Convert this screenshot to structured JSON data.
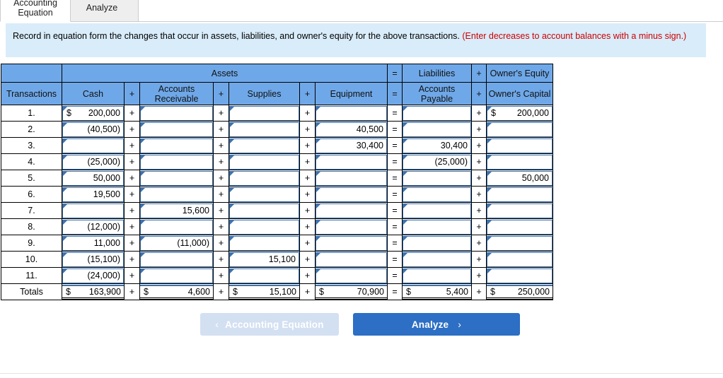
{
  "tabs": [
    {
      "label": "Accounting Equation",
      "active": true
    },
    {
      "label": "Analyze",
      "active": false
    }
  ],
  "instruction": {
    "main": "Record in equation form the changes that occur in assets, liabilities, and owner's equity for the above transactions.",
    "note": "(Enter decreases to account balances with a minus sign.)"
  },
  "table": {
    "group_headers": {
      "blank": "",
      "assets": "Assets",
      "eq": "=",
      "liabilities": "Liabilities",
      "plus": "+",
      "owners_equity": "Owner's Equity"
    },
    "column_headers": {
      "transactions": "Transactions",
      "cash": "Cash",
      "op1": "+",
      "accounts_receivable": "Accounts Receivable",
      "op2": "+",
      "supplies": "Supplies",
      "op3": "+",
      "equipment": "Equipment",
      "op4": "=",
      "accounts_payable": "Accounts Payable",
      "op5": "+",
      "owners_capital": "Owner's Capital"
    },
    "operators": {
      "plus": "+",
      "equals": "="
    },
    "dollar": "$",
    "totals_label": "Totals",
    "rows": [
      {
        "num": "1.",
        "cash": "200,000",
        "cash_dollar": true,
        "ar": "",
        "supplies": "",
        "equipment": "",
        "ap": "",
        "capital": "200,000",
        "capital_dollar": true
      },
      {
        "num": "2.",
        "cash": "(40,500)",
        "cash_dollar": false,
        "ar": "",
        "supplies": "",
        "equipment": "40,500",
        "ap": "",
        "capital": "",
        "capital_dollar": false
      },
      {
        "num": "3.",
        "cash": "",
        "cash_dollar": false,
        "ar": "",
        "supplies": "",
        "equipment": "30,400",
        "ap": "30,400",
        "capital": "",
        "capital_dollar": false
      },
      {
        "num": "4.",
        "cash": "(25,000)",
        "cash_dollar": false,
        "ar": "",
        "supplies": "",
        "equipment": "",
        "ap": "(25,000)",
        "capital": "",
        "capital_dollar": false
      },
      {
        "num": "5.",
        "cash": "50,000",
        "cash_dollar": false,
        "ar": "",
        "supplies": "",
        "equipment": "",
        "ap": "",
        "capital": "50,000",
        "capital_dollar": false
      },
      {
        "num": "6.",
        "cash": "19,500",
        "cash_dollar": false,
        "ar": "",
        "supplies": "",
        "equipment": "",
        "ap": "",
        "capital": "",
        "capital_dollar": false
      },
      {
        "num": "7.",
        "cash": "",
        "cash_dollar": false,
        "ar": "15,600",
        "supplies": "",
        "equipment": "",
        "ap": "",
        "capital": "",
        "capital_dollar": false
      },
      {
        "num": "8.",
        "cash": "(12,000)",
        "cash_dollar": false,
        "ar": "",
        "supplies": "",
        "equipment": "",
        "ap": "",
        "capital": "",
        "capital_dollar": false
      },
      {
        "num": "9.",
        "cash": "11,000",
        "cash_dollar": false,
        "ar": "(11,000)",
        "supplies": "",
        "equipment": "",
        "ap": "",
        "capital": "",
        "capital_dollar": false
      },
      {
        "num": "10.",
        "cash": "(15,100)",
        "cash_dollar": false,
        "ar": "",
        "supplies": "15,100",
        "equipment": "",
        "ap": "",
        "capital": "",
        "capital_dollar": false
      },
      {
        "num": "11.",
        "cash": "(24,000)",
        "cash_dollar": false,
        "ar": "",
        "supplies": "",
        "equipment": "",
        "ap": "",
        "capital": "",
        "capital_dollar": false
      }
    ],
    "totals": {
      "cash": "163,900",
      "ar": "4,600",
      "supplies": "15,100",
      "equipment": "70,900",
      "ap": "5,400",
      "capital": "250,000"
    }
  },
  "footer": {
    "prev_label": "Accounting Equation",
    "prev_chevron": "‹",
    "next_label": "Analyze",
    "next_chevron": "›"
  }
}
